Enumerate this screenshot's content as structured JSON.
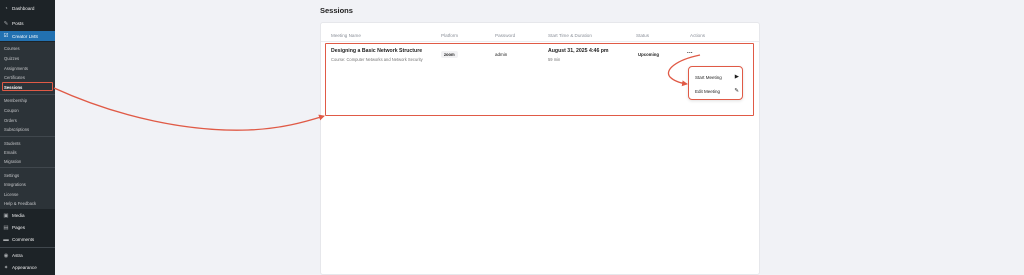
{
  "sidebar": {
    "top_items": [
      {
        "label": "Dashboard",
        "icon": "dashboard-icon",
        "glyph": "◔"
      },
      {
        "label": "Posts",
        "icon": "pin-icon",
        "glyph": "✎"
      }
    ],
    "current_plugin": {
      "label": "Creator LMS",
      "icon": "creator-lms-icon",
      "glyph": "☑"
    },
    "sub_groups": [
      [
        "Courses",
        "Quizzes",
        "Assignments",
        "Certificates",
        "Sessions"
      ],
      [
        "Membership",
        "Coupon",
        "Orders",
        "Subscriptions"
      ],
      [
        "Students",
        "Emails",
        "Migration"
      ],
      [
        "Settings",
        "Integrations",
        "License",
        "Help & Feedback"
      ]
    ],
    "active_sub": "Sessions",
    "bottom_items": [
      {
        "label": "Media",
        "icon": "media-icon",
        "glyph": "▣"
      },
      {
        "label": "Pages",
        "icon": "pages-icon",
        "glyph": "▤"
      },
      {
        "label": "Comments",
        "icon": "comments-icon",
        "glyph": "▬"
      },
      {
        "label": "Astra",
        "icon": "astra-icon",
        "glyph": "◉"
      },
      {
        "label": "Appearance",
        "icon": "appearance-icon",
        "glyph": "✦"
      }
    ]
  },
  "page": {
    "title": "Sessions"
  },
  "table": {
    "headers": [
      "Meeting Name",
      "Platform",
      "Password",
      "Start Time & Duration",
      "Status",
      "Actions"
    ],
    "row": {
      "name": "Designing a Basic Network Structure",
      "course": "Course: Computer Networks and Network Security",
      "platform": "zoom",
      "password": "admin",
      "start_time": "August 31, 2025 4:46 pm",
      "duration": "59 min",
      "status": "Upcoming",
      "actions_label": "..."
    }
  },
  "dropdown": {
    "items": [
      {
        "label": "Start Meeting",
        "icon": "play-icon",
        "glyph": "▶"
      },
      {
        "label": "Edit Meeting",
        "icon": "pencil-icon",
        "glyph": "✎"
      }
    ]
  },
  "colors": {
    "sidebar_bg": "#1d2327",
    "sidebar_sub_bg": "#2c3338",
    "accent": "#2271b1",
    "annotation": "#e05a46"
  }
}
